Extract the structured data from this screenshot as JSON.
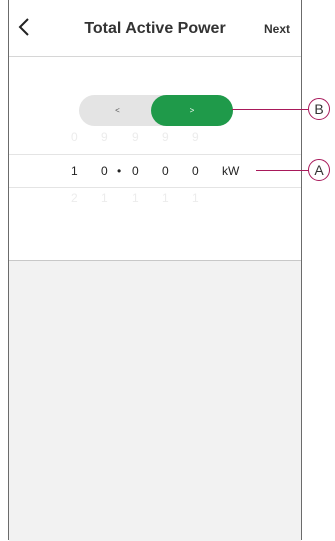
{
  "header": {
    "title": "Total Active Power",
    "next_label": "Next",
    "back_icon": "chevron-left-icon"
  },
  "toggle": {
    "left_label": "<",
    "right_label": ">",
    "active_color": "#1f9a4a"
  },
  "picker": {
    "row_above": [
      "0",
      "9",
      "9",
      "9",
      "9"
    ],
    "selected": [
      "1",
      "0",
      "•",
      "0",
      "0",
      "0"
    ],
    "unit": "kW",
    "row_below": [
      "2",
      "1",
      "1",
      "1",
      "1"
    ]
  },
  "callouts": {
    "a": "A",
    "b": "B",
    "color": "#a8195a"
  }
}
